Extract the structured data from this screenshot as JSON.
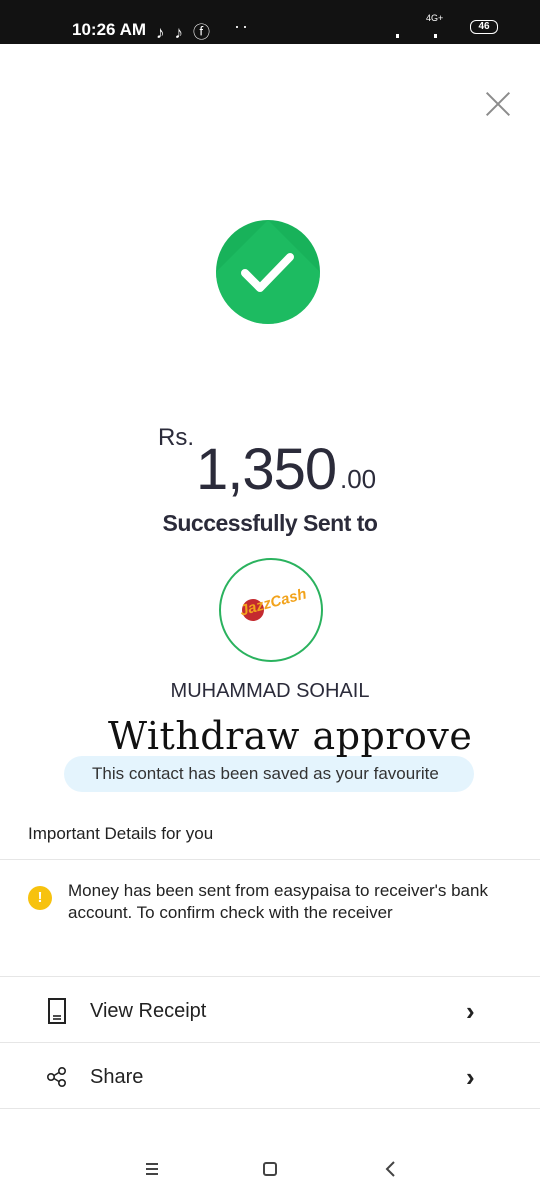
{
  "status_bar": {
    "time": "10:26 AM",
    "network": "4G+",
    "battery": "46"
  },
  "header": {
    "close_icon": "close-icon"
  },
  "transaction": {
    "currency": "Rs.",
    "amount": "1,350",
    "decimals": ".00",
    "status": "Successfully Sent to",
    "receiver_name": "MUHAMMAD SOHAIL",
    "bank_logo_text": "JazzCash",
    "overlay_text": "Withdraw approve",
    "favourite_notice": "This contact has been saved as your favourite"
  },
  "details": {
    "title": "Important Details for you",
    "message": "Money has been sent from easypaisa to receiver's bank account. To confirm check with the receiver"
  },
  "actions": [
    {
      "label": "View Receipt",
      "icon": "receipt-icon"
    },
    {
      "label": "Share",
      "icon": "share-icon"
    }
  ],
  "colors": {
    "success": "#18b25a",
    "warning": "#f7c20e",
    "favourite_bg": "#e4f4fd"
  }
}
